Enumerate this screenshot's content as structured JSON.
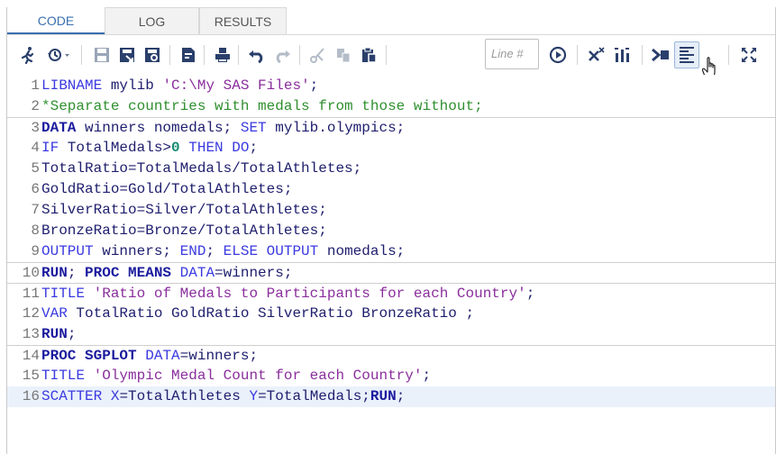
{
  "tabs": [
    {
      "label": "CODE",
      "active": true
    },
    {
      "label": "LOG",
      "active": false
    },
    {
      "label": "RESULTS",
      "active": false
    }
  ],
  "toolbar": {
    "line_placeholder": "Line #",
    "icons": [
      "run-icon",
      "history-icon",
      "save-icon",
      "save-as-icon",
      "save-template-icon",
      "copy-file-icon",
      "print-icon",
      "undo-icon",
      "redo-icon",
      "cut-icon",
      "copy-icon",
      "paste-icon",
      "go-to-line-icon",
      "clear-icon",
      "format-code-icon",
      "submit-selection-icon",
      "snippet-icon",
      "maximize-icon"
    ]
  },
  "editor": {
    "lines": [
      {
        "num": "1",
        "tokens": [
          {
            "t": "LIBNAME",
            "c": "kw2"
          },
          {
            "t": " mylib ",
            "c": "plain"
          },
          {
            "t": "'C:\\My SAS Files'",
            "c": "str"
          },
          {
            "t": ";",
            "c": "plain"
          }
        ]
      },
      {
        "num": "2",
        "tokens": [
          {
            "t": "*Separate countries with medals from those without;",
            "c": "cmt"
          }
        ]
      },
      {
        "num": "3",
        "sep": true,
        "tokens": [
          {
            "t": "DATA",
            "c": "kw"
          },
          {
            "t": " winners nomedals; ",
            "c": "plain"
          },
          {
            "t": "SET",
            "c": "kw2"
          },
          {
            "t": " mylib.olympics;",
            "c": "plain"
          }
        ]
      },
      {
        "num": "4",
        "tokens": [
          {
            "t": "IF",
            "c": "kw2"
          },
          {
            "t": " TotalMedals>",
            "c": "plain"
          },
          {
            "t": "0",
            "c": "num"
          },
          {
            "t": " ",
            "c": "plain"
          },
          {
            "t": "THEN DO",
            "c": "kw2"
          },
          {
            "t": ";",
            "c": "plain"
          }
        ]
      },
      {
        "num": "5",
        "tokens": [
          {
            "t": "TotalRatio=TotalMedals/TotalAthletes;",
            "c": "plain"
          }
        ]
      },
      {
        "num": "6",
        "tokens": [
          {
            "t": "GoldRatio=Gold/TotalAthletes;",
            "c": "plain"
          }
        ]
      },
      {
        "num": "7",
        "tokens": [
          {
            "t": "SilverRatio=Silver/TotalAthletes;",
            "c": "plain"
          }
        ]
      },
      {
        "num": "8",
        "tokens": [
          {
            "t": "BronzeRatio=Bronze/TotalAthletes;",
            "c": "plain"
          }
        ]
      },
      {
        "num": "9",
        "tokens": [
          {
            "t": "OUTPUT",
            "c": "kw2"
          },
          {
            "t": " winners; ",
            "c": "plain"
          },
          {
            "t": "END",
            "c": "kw2"
          },
          {
            "t": "; ",
            "c": "plain"
          },
          {
            "t": "ELSE OUTPUT",
            "c": "kw2"
          },
          {
            "t": " nomedals;",
            "c": "plain"
          }
        ]
      },
      {
        "num": "10",
        "sep": true,
        "tokens": [
          {
            "t": "RUN",
            "c": "kw"
          },
          {
            "t": "; ",
            "c": "plain"
          },
          {
            "t": "PROC MEANS",
            "c": "kw"
          },
          {
            "t": " ",
            "c": "plain"
          },
          {
            "t": "DATA",
            "c": "kw2"
          },
          {
            "t": "=winners;",
            "c": "plain"
          }
        ]
      },
      {
        "num": "11",
        "sep": true,
        "tokens": [
          {
            "t": "TITLE",
            "c": "kw2"
          },
          {
            "t": " ",
            "c": "plain"
          },
          {
            "t": "'Ratio of Medals to Participants for each Country'",
            "c": "str"
          },
          {
            "t": ";",
            "c": "plain"
          }
        ]
      },
      {
        "num": "12",
        "tokens": [
          {
            "t": "VAR",
            "c": "kw2"
          },
          {
            "t": " TotalRatio GoldRatio SilverRatio BronzeRatio ;",
            "c": "plain"
          }
        ]
      },
      {
        "num": "13",
        "tokens": [
          {
            "t": "RUN",
            "c": "kw"
          },
          {
            "t": ";",
            "c": "plain"
          }
        ]
      },
      {
        "num": "14",
        "sep": true,
        "tokens": [
          {
            "t": "PROC SGPLOT",
            "c": "kw"
          },
          {
            "t": " ",
            "c": "plain"
          },
          {
            "t": "DATA",
            "c": "kw2"
          },
          {
            "t": "=winners;",
            "c": "plain"
          }
        ]
      },
      {
        "num": "15",
        "tokens": [
          {
            "t": "TITLE",
            "c": "kw2"
          },
          {
            "t": " ",
            "c": "plain"
          },
          {
            "t": "'Olympic Medal Count for each Country'",
            "c": "str"
          },
          {
            "t": ";",
            "c": "plain"
          }
        ]
      },
      {
        "num": "16",
        "current": true,
        "tokens": [
          {
            "t": "SCATTER",
            "c": "kw2"
          },
          {
            "t": " ",
            "c": "plain"
          },
          {
            "t": "X",
            "c": "kw2"
          },
          {
            "t": "=TotalAthletes ",
            "c": "plain"
          },
          {
            "t": "Y",
            "c": "kw2"
          },
          {
            "t": "=TotalMedals;",
            "c": "plain"
          },
          {
            "t": "RUN",
            "c": "kw"
          },
          {
            "t": ";",
            "c": "plain"
          }
        ]
      }
    ]
  },
  "colors": {
    "accent": "#3a6fb0",
    "keyword": "#1b1b9e",
    "string": "#8a2e9c",
    "comment": "#2f8f2f",
    "number": "#138a72"
  }
}
